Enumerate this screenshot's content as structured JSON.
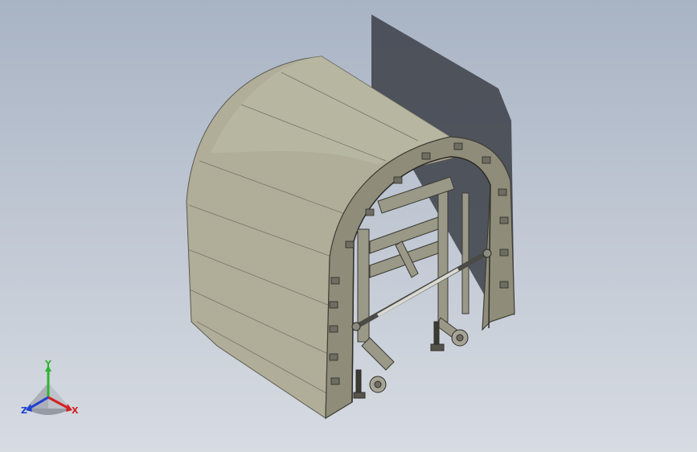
{
  "viewport": {
    "colors": {
      "background_top": "#a8b3c4",
      "background_bottom": "#d7dbe2",
      "shell": "#b0ae98",
      "shell_dark": "#8f8d7a",
      "frame": "#6f6d62",
      "shadow": "#3c4048"
    }
  },
  "triad": {
    "y_label": "Y",
    "x_label": "X",
    "z_label": "Z",
    "y_color": "#2fb52f",
    "x_color": "#d42020",
    "z_color": "#1e3fd0"
  }
}
